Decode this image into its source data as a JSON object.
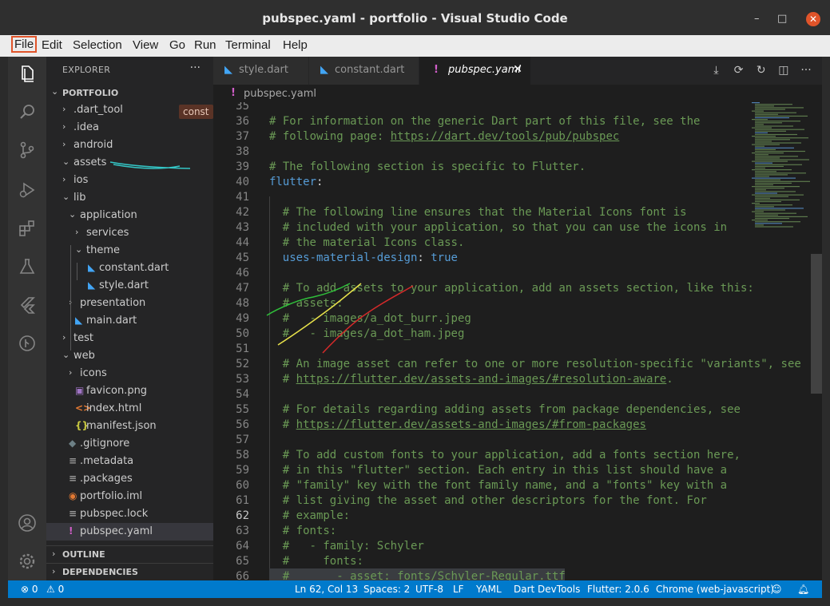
{
  "window": {
    "title": "pubspec.yaml - portfolio - Visual Studio Code",
    "minimize": "–",
    "maximize": "□",
    "close": "✕"
  },
  "menu": [
    "File",
    "Edit",
    "Selection",
    "View",
    "Go",
    "Run",
    "Terminal",
    "Help"
  ],
  "activity_icons": [
    "explorer-icon",
    "search-icon",
    "source-control-icon",
    "run-debug-icon",
    "extensions-icon",
    "testing-icon",
    "flutter-icon",
    "git-graph-icon",
    "account-icon",
    "settings-gear-icon"
  ],
  "sidebar": {
    "header": "EXPLORER",
    "more": "···",
    "root": "PORTFOLIO",
    "tooltip": "const",
    "tree": [
      {
        "label": ".dart_tool",
        "depth": 1,
        "kind": "folder",
        "open": false
      },
      {
        "label": ".idea",
        "depth": 1,
        "kind": "folder",
        "open": false
      },
      {
        "label": "android",
        "depth": 1,
        "kind": "folder",
        "open": false
      },
      {
        "label": "assets",
        "depth": 1,
        "kind": "folder",
        "open": true
      },
      {
        "label": "ios",
        "depth": 1,
        "kind": "folder",
        "open": false
      },
      {
        "label": "lib",
        "depth": 1,
        "kind": "folder",
        "open": true
      },
      {
        "label": "application",
        "depth": 2,
        "kind": "folder",
        "open": true
      },
      {
        "label": "services",
        "depth": 3,
        "kind": "folder",
        "open": false
      },
      {
        "label": "theme",
        "depth": 3,
        "kind": "folder",
        "open": true
      },
      {
        "label": "constant.dart",
        "depth": 4,
        "kind": "dart"
      },
      {
        "label": "style.dart",
        "depth": 4,
        "kind": "dart"
      },
      {
        "label": "presentation",
        "depth": 2,
        "kind": "folder",
        "open": false
      },
      {
        "label": "main.dart",
        "depth": 2,
        "kind": "dart"
      },
      {
        "label": "test",
        "depth": 1,
        "kind": "folder",
        "open": false
      },
      {
        "label": "web",
        "depth": 1,
        "kind": "folder",
        "open": true
      },
      {
        "label": "icons",
        "depth": 2,
        "kind": "folder",
        "open": false
      },
      {
        "label": "favicon.png",
        "depth": 2,
        "kind": "png"
      },
      {
        "label": "index.html",
        "depth": 2,
        "kind": "html"
      },
      {
        "label": "manifest.json",
        "depth": 2,
        "kind": "json"
      },
      {
        "label": ".gitignore",
        "depth": 1,
        "kind": "git"
      },
      {
        "label": ".metadata",
        "depth": 1,
        "kind": "text"
      },
      {
        "label": ".packages",
        "depth": 1,
        "kind": "text"
      },
      {
        "label": "portfolio.iml",
        "depth": 1,
        "kind": "iml"
      },
      {
        "label": "pubspec.lock",
        "depth": 1,
        "kind": "text"
      },
      {
        "label": "pubspec.yaml",
        "depth": 1,
        "kind": "yaml",
        "selected": true
      }
    ],
    "sections": [
      "OUTLINE",
      "DEPENDENCIES"
    ]
  },
  "tabs": [
    {
      "label": "style.dart",
      "icon": "dart",
      "active": false
    },
    {
      "label": "constant.dart",
      "icon": "dart",
      "active": false
    },
    {
      "label": "pubspec.yaml",
      "icon": "yaml",
      "active": true,
      "close": "✕"
    }
  ],
  "tab_actions": [
    "download-icon",
    "refresh-icon",
    "history-icon",
    "split-editor-icon",
    "more-actions-icon"
  ],
  "breadcrumb": {
    "icon": "!",
    "file": "pubspec.yaml"
  },
  "editor": {
    "current_line": 62,
    "lines": [
      {
        "n": 35,
        "indent": 0,
        "parts": []
      },
      {
        "n": 36,
        "indent": 0,
        "parts": [
          {
            "t": "cmt",
            "s": "# For information on the generic Dart part of this file, see the"
          }
        ]
      },
      {
        "n": 37,
        "indent": 0,
        "parts": [
          {
            "t": "cmt",
            "s": "# following page: "
          },
          {
            "t": "lnk",
            "s": "https://dart.dev/tools/pub/pubspec"
          }
        ]
      },
      {
        "n": 38,
        "indent": 0,
        "parts": []
      },
      {
        "n": 39,
        "indent": 0,
        "parts": [
          {
            "t": "cmt",
            "s": "# The following section is specific to Flutter."
          }
        ]
      },
      {
        "n": 40,
        "indent": 0,
        "parts": [
          {
            "t": "key",
            "s": "flutter"
          },
          {
            "t": "plain",
            "s": ":"
          }
        ]
      },
      {
        "n": 41,
        "indent": 0,
        "parts": []
      },
      {
        "n": 42,
        "indent": 2,
        "parts": [
          {
            "t": "cmt",
            "s": "# The following line ensures that the Material Icons font is"
          }
        ]
      },
      {
        "n": 43,
        "indent": 2,
        "parts": [
          {
            "t": "cmt",
            "s": "# included with your application, so that you can use the icons in"
          }
        ]
      },
      {
        "n": 44,
        "indent": 2,
        "parts": [
          {
            "t": "cmt",
            "s": "# the material Icons class."
          }
        ]
      },
      {
        "n": 45,
        "indent": 2,
        "parts": [
          {
            "t": "key",
            "s": "uses-material-design"
          },
          {
            "t": "plain",
            "s": ": "
          },
          {
            "t": "bool",
            "s": "true"
          }
        ]
      },
      {
        "n": 46,
        "indent": 0,
        "parts": []
      },
      {
        "n": 47,
        "indent": 2,
        "parts": [
          {
            "t": "cmt",
            "s": "# To add assets to your application, add an assets section, like this:"
          }
        ]
      },
      {
        "n": 48,
        "indent": 2,
        "parts": [
          {
            "t": "cmt",
            "s": "# assets:"
          }
        ]
      },
      {
        "n": 49,
        "indent": 2,
        "parts": [
          {
            "t": "cmt",
            "s": "#   - images/a_dot_burr.jpeg"
          }
        ]
      },
      {
        "n": 50,
        "indent": 2,
        "parts": [
          {
            "t": "cmt",
            "s": "#   - images/a_dot_ham.jpeg"
          }
        ]
      },
      {
        "n": 51,
        "indent": 0,
        "parts": []
      },
      {
        "n": 52,
        "indent": 2,
        "parts": [
          {
            "t": "cmt",
            "s": "# An image asset can refer to one or more resolution-specific \"variants\", see"
          }
        ]
      },
      {
        "n": 53,
        "indent": 2,
        "parts": [
          {
            "t": "cmt",
            "s": "# "
          },
          {
            "t": "lnk",
            "s": "https://flutter.dev/assets-and-images/#resolution-aware"
          },
          {
            "t": "cmt",
            "s": "."
          }
        ]
      },
      {
        "n": 54,
        "indent": 0,
        "parts": []
      },
      {
        "n": 55,
        "indent": 2,
        "parts": [
          {
            "t": "cmt",
            "s": "# For details regarding adding assets from package dependencies, see"
          }
        ]
      },
      {
        "n": 56,
        "indent": 2,
        "parts": [
          {
            "t": "cmt",
            "s": "# "
          },
          {
            "t": "lnk",
            "s": "https://flutter.dev/assets-and-images/#from-packages"
          }
        ]
      },
      {
        "n": 57,
        "indent": 0,
        "parts": []
      },
      {
        "n": 58,
        "indent": 2,
        "parts": [
          {
            "t": "cmt",
            "s": "# To add custom fonts to your application, add a fonts section here,"
          }
        ]
      },
      {
        "n": 59,
        "indent": 2,
        "parts": [
          {
            "t": "cmt",
            "s": "# in this \"flutter\" section. Each entry in this list should have a"
          }
        ]
      },
      {
        "n": 60,
        "indent": 2,
        "parts": [
          {
            "t": "cmt",
            "s": "# \"family\" key with the font family name, and a \"fonts\" key with a"
          }
        ]
      },
      {
        "n": 61,
        "indent": 2,
        "parts": [
          {
            "t": "cmt",
            "s": "# list giving the asset and other descriptors for the font. For"
          }
        ]
      },
      {
        "n": 62,
        "indent": 2,
        "parts": [
          {
            "t": "cmt",
            "s": "# example:"
          }
        ]
      },
      {
        "n": 63,
        "indent": 2,
        "parts": [
          {
            "t": "cmt",
            "s": "# fonts:"
          }
        ]
      },
      {
        "n": 64,
        "indent": 2,
        "parts": [
          {
            "t": "cmt",
            "s": "#   - family: Schyler"
          }
        ]
      },
      {
        "n": 65,
        "indent": 2,
        "parts": [
          {
            "t": "cmt",
            "s": "#     fonts:"
          }
        ]
      },
      {
        "n": 66,
        "indent": 2,
        "parts": [
          {
            "t": "cmt",
            "s": "#       - asset: fonts/Schyler-Regular.ttf"
          }
        ]
      }
    ]
  },
  "status": {
    "errors": "⊗ 0",
    "warnings": "⚠ 0",
    "position": "Ln 62, Col 13",
    "spaces": "Spaces: 2",
    "encoding": "UTF-8",
    "eol": "LF",
    "language": "YAML",
    "devtools": "Dart DevTools",
    "flutter": "Flutter: 2.0.6",
    "device": "Chrome (web-javascript)",
    "feedback_icon": "feedback-icon",
    "bell_icon": "bell-icon"
  },
  "colors": {
    "accent": "#007acc",
    "editor_bg": "#1e1e1e",
    "comment": "#6a9955",
    "keyword": "#569cd6",
    "dart_icon": "#42a5f5",
    "yaml_icon": "#d15ec9"
  }
}
